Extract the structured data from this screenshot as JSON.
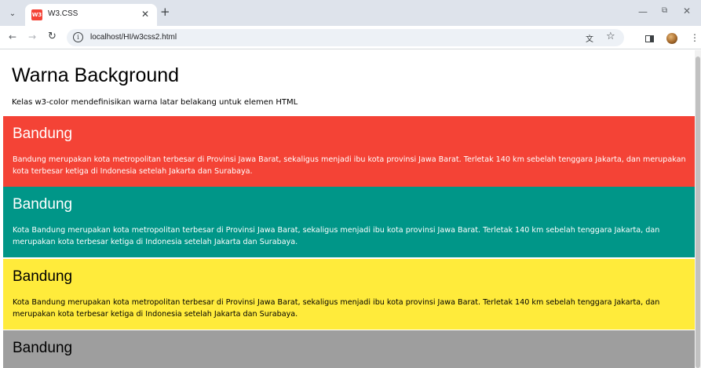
{
  "browser": {
    "tab_title": "W3.CSS",
    "tab_favicon_text": "W3",
    "url": "localhost/HI/w3css2.html"
  },
  "icons": {
    "tab_search": "chevron-down-icon",
    "tab_close": "close-icon",
    "new_tab": "plus-icon",
    "minimize": "minimize-icon",
    "restore": "restore-icon",
    "window_close": "close-icon",
    "back": "arrow-left-icon",
    "forward": "arrow-right-icon",
    "reload": "reload-icon",
    "site_info": "info-icon",
    "translate": "translate-icon",
    "bookmark": "star-icon",
    "side_panel": "side-panel-icon",
    "profile": "avatar",
    "menu": "kebab-menu-icon"
  },
  "page": {
    "title": "Warna Background",
    "description": "Kelas w3-color mendefinisikan warna latar belakang untuk elemen HTML",
    "panels": [
      {
        "color_name": "red",
        "bg": "#f44336",
        "fg": "#ffffff",
        "title": "Bandung",
        "text": "Bandung merupakan kota metropolitan terbesar di Provinsi Jawa Barat, sekaligus menjadi ibu kota provinsi Jawa Barat. Terletak 140 km sebelah tenggara Jakarta, dan merupakan kota terbesar ketiga di Indonesia setelah Jakarta dan Surabaya."
      },
      {
        "color_name": "teal",
        "bg": "#009688",
        "fg": "#ffffff",
        "title": "Bandung",
        "text": "Kota Bandung merupakan kota metropolitan terbesar di Provinsi Jawa Barat, sekaligus menjadi ibu kota provinsi Jawa Barat. Terletak 140 km sebelah tenggara Jakarta, dan merupakan kota terbesar ketiga di Indonesia setelah Jakarta dan Surabaya."
      },
      {
        "color_name": "yellow",
        "bg": "#ffeb3b",
        "fg": "#000000",
        "title": "Bandung",
        "text": "Kota Bandung merupakan kota metropolitan terbesar di Provinsi Jawa Barat, sekaligus menjadi ibu kota provinsi Jawa Barat. Terletak 140 km sebelah tenggara Jakarta, dan merupakan kota terbesar ketiga di Indonesia setelah Jakarta dan Surabaya."
      },
      {
        "color_name": "grey",
        "bg": "#9e9e9e",
        "fg": "#000000",
        "title": "Bandung"
      }
    ]
  }
}
